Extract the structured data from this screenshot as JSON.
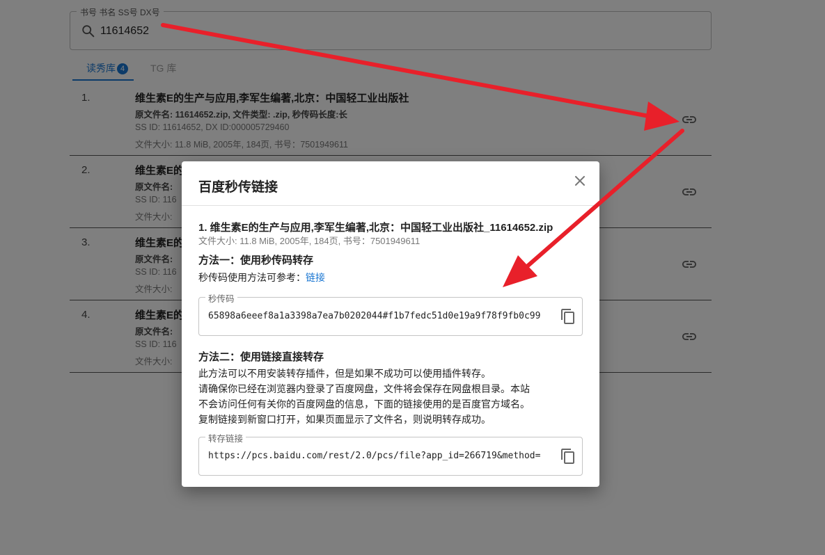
{
  "search": {
    "label": "书号 书名 SS号 DX号",
    "value": "11614652"
  },
  "tabs": [
    {
      "label": "读秀库",
      "badge": "4",
      "active": true
    },
    {
      "label": "TG 库",
      "active": false
    }
  ],
  "results": [
    {
      "num": "1.",
      "title": "维生素E的生产与应用,李军生编著,北京：中国轻工业出版社",
      "original_name": "原文件名: 11614652.zip, 文件类型: .zip, 秒传码长度:长",
      "ids": "SS ID: 11614652, DX ID:000005729460",
      "size": "文件大小: 11.8 MiB, 2005年, 184页, 书号：7501949611"
    },
    {
      "num": "2.",
      "title": "维生素E的",
      "original_name": "原文件名:",
      "ids": "SS ID: 116",
      "size": "文件大小:"
    },
    {
      "num": "3.",
      "title": "维生素E的",
      "original_name": "原文件名:",
      "ids": "SS ID: 116",
      "size": "文件大小:"
    },
    {
      "num": "4.",
      "title": "维生素E的",
      "original_name": "原文件名:",
      "ids": "SS ID: 116",
      "size": "文件大小:"
    }
  ],
  "dialog": {
    "title": "百度秒传链接",
    "file_title": "1. 维生素E的生产与应用,李军生编著,北京：中国轻工业出版社_11614652.zip",
    "file_meta": "文件大小: 11.8 MiB, 2005年, 184页, 书号：7501949611",
    "method1": {
      "heading": "方法一：使用秒传码转存",
      "hint": "秒传码使用方法可参考：",
      "hint_link": "链接",
      "field_label": "秒传码",
      "field_value": "65898a6eeef8a1a3398a7ea7b0202044#f1b7fedc51d0e19a9f78f9fb0c99"
    },
    "method2": {
      "heading": "方法二：使用链接直接转存",
      "paragraph": [
        "此方法可以不用安装转存插件，但是如果不成功可以使用插件转存。",
        "请确保你已经在浏览器内登录了百度网盘，文件将会保存在网盘根目录。本站",
        "不会访问任何有关你的百度网盘的信息，下面的链接使用的是百度官方域名。",
        "复制链接到新窗口打开，如果页面显示了文件名，则说明转存成功。"
      ],
      "field_label": "转存链接",
      "field_value": "https://pcs.baidu.com/rest/2.0/pcs/file?app_id=266719&method="
    }
  },
  "icons": {
    "search": "search-icon",
    "link": "link-icon",
    "close": "close-icon",
    "copy": "copy-icon"
  },
  "colors": {
    "accent": "#1976d2",
    "annotation_arrow": "#e8202a",
    "overlay": "rgba(0,0,0,0.5)"
  }
}
